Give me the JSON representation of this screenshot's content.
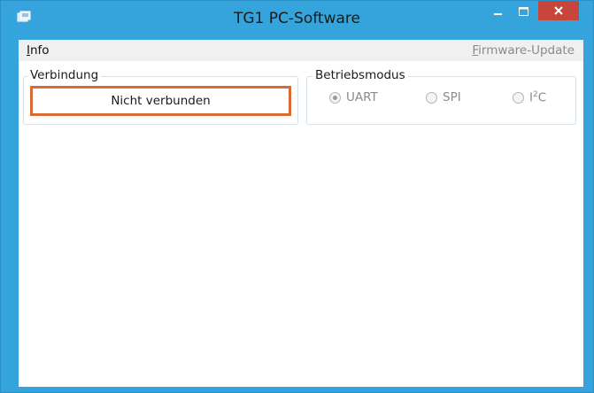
{
  "window": {
    "title": "TG1 PC-Software",
    "colors": {
      "frame": "#36a4dc",
      "close": "#c7453a",
      "status_border": "#d86a33"
    }
  },
  "menu": {
    "info_label": "Info",
    "info_underline": "I",
    "info_rest": "nfo",
    "firmware_label": "Firmware-Update",
    "firmware_underline": "F",
    "firmware_rest": "irmware-Update"
  },
  "connection": {
    "group_label": "Verbindung",
    "status_text": "Nicht verbunden"
  },
  "mode": {
    "group_label": "Betriebsmodus",
    "options": [
      {
        "label": "UART",
        "selected": true
      },
      {
        "label": "SPI",
        "selected": false
      },
      {
        "label_base": "I",
        "label_sup": "2",
        "label_rest": "C",
        "selected": false
      }
    ]
  },
  "icons": {
    "app": "app-icon",
    "minimize": "minimize-icon",
    "maximize": "maximize-icon",
    "close": "close-icon"
  }
}
